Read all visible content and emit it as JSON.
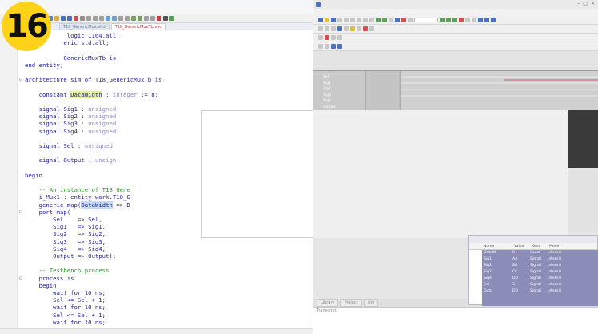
{
  "badge": {
    "number": "16"
  },
  "editor": {
    "tabs": [
      "T18_GenericMux.vhd",
      "T18_GenericMuxTb.vhd"
    ],
    "active_tab": 1,
    "lines": [
      {
        "n": "",
        "fold": "",
        "html": "            <span class='kw'>logic</span> 1164.<span class='kw'>all</span>;"
      },
      {
        "n": "",
        "fold": "",
        "html": "           <span class='kw'>eric</span> std.<span class='kw'>all</span>;"
      },
      {
        "n": "",
        "fold": "",
        "html": ""
      },
      {
        "n": "",
        "fold": "",
        "html": "           GenericMuxTb <span class='kw'>is</span>"
      },
      {
        "n": "",
        "fold": "",
        "html": "<span class='kw'>end entity</span>;"
      },
      {
        "n": "",
        "fold": "",
        "html": ""
      },
      {
        "n": "",
        "fold": "⊟",
        "html": "<span class='kw'>architecture</span> sim <span class='kw'>of</span> T18_GenericMuxTb <span class='kw'>is</span>"
      },
      {
        "n": "",
        "fold": "",
        "html": ""
      },
      {
        "n": "",
        "fold": "",
        "html": "    <span class='kw'>constant</span> <span class='hl'>DataWidth</span> : <span class='ty'>integer</span> := 8;"
      },
      {
        "n": "",
        "fold": "",
        "html": ""
      },
      {
        "n": "",
        "fold": "",
        "html": "    <span class='kw'>signal</span> Sig1 : <span class='ty'>unsigned</span>"
      },
      {
        "n": "",
        "fold": "",
        "html": "    <span class='kw'>signal</span> Sig2 : <span class='ty'>unsigned</span>"
      },
      {
        "n": "",
        "fold": "",
        "html": "    <span class='kw'>signal</span> Sig3 : <span class='ty'>unsigned</span>"
      },
      {
        "n": "",
        "fold": "",
        "html": "    <span class='kw'>signal</span> Sig4 : <span class='ty'>unsigned</span>"
      },
      {
        "n": "",
        "fold": "",
        "html": ""
      },
      {
        "n": "",
        "fold": "",
        "html": "    <span class='kw'>signal</span> Sel : <span class='ty'>unsigned</span>"
      },
      {
        "n": "",
        "fold": "",
        "html": ""
      },
      {
        "n": "",
        "fold": "",
        "html": "    <span class='kw'>signal</span> Output : <span class='ty'>unsign</span>"
      },
      {
        "n": "",
        "fold": "",
        "html": ""
      },
      {
        "n": "",
        "fold": "",
        "html": "<span class='kw'>begin</span>"
      },
      {
        "n": "",
        "fold": "",
        "html": ""
      },
      {
        "n": "",
        "fold": "",
        "html": "    <span class='cm'>-- An instance of T18_Gene</span>"
      },
      {
        "n": "",
        "fold": "",
        "html": "    i_Mux1 : <span class='kw'>entity</span> work.T18_G"
      },
      {
        "n": "",
        "fold": "",
        "html": "    <span class='kw'>generic map</span>(<span class='sel'>DataWidth</span> => D"
      },
      {
        "n": "",
        "fold": "⊟",
        "html": "    <span class='kw'>port map</span>("
      },
      {
        "n": "",
        "fold": "",
        "html": "        Sel    => Sel,"
      },
      {
        "n": "",
        "fold": "",
        "html": "        Sig1   => Sig1,"
      },
      {
        "n": "",
        "fold": "",
        "html": "        Sig2   => Sig2,"
      },
      {
        "n": "",
        "fold": "",
        "html": "        Sig3   => Sig3,"
      },
      {
        "n": "",
        "fold": "",
        "html": "        Sig4   => Sig4,"
      },
      {
        "n": "",
        "fold": "",
        "html": "        Output => Output);"
      },
      {
        "n": "",
        "fold": "",
        "html": ""
      },
      {
        "n": "",
        "fold": "",
        "html": "    <span class='cm'>-- Testbench process</span>"
      },
      {
        "n": "",
        "fold": "⊟",
        "html": "    <span class='kw'>process is</span>"
      },
      {
        "n": "",
        "fold": "",
        "html": "    <span class='kw'>begin</span>"
      },
      {
        "n": "",
        "fold": "",
        "html": "        <span class='kw'>wait for</span> 10 ns;"
      },
      {
        "n": "",
        "fold": "",
        "html": "        Sel <= Sel + 1;"
      },
      {
        "n": "",
        "fold": "",
        "html": "        <span class='kw'>wait for</span> 10 ns;"
      },
      {
        "n": "",
        "fold": "",
        "html": "        Sel <= Sel + 1;"
      },
      {
        "n": "",
        "fold": "",
        "html": "        <span class='kw'>wait for</span> 10 ns;"
      }
    ]
  },
  "sim": {
    "wave": {
      "signals": [
        "Sel",
        "Sig1",
        "Sig2",
        "Sig3",
        "Sig4",
        "Output"
      ]
    },
    "objects": {
      "columns": [
        "Name",
        "Value",
        "Kind",
        "Mode"
      ],
      "rows": [
        {
          "name": "DataW",
          "value": "8",
          "kind": "Const",
          "mode": "Internal"
        },
        {
          "name": "Sig1",
          "value": "AA",
          "kind": "Signal",
          "mode": "Internal"
        },
        {
          "name": "Sig2",
          "value": "BB",
          "kind": "Signal",
          "mode": "Internal"
        },
        {
          "name": "Sig3",
          "value": "CC",
          "kind": "Signal",
          "mode": "Internal"
        },
        {
          "name": "Sig4",
          "value": "DD",
          "kind": "Signal",
          "mode": "Internal"
        },
        {
          "name": "Sel",
          "value": "3",
          "kind": "Signal",
          "mode": "Internal"
        },
        {
          "name": "Outp",
          "value": "DD",
          "kind": "Signal",
          "mode": "Internal"
        }
      ]
    },
    "bottom_tabs": [
      "Library",
      "Project",
      "sim"
    ],
    "transcript_title": "Transcript"
  },
  "colors": {
    "badge": "#ffd21a",
    "objects_body": "#8c8cb8",
    "wave_bg": "#bcbcbc"
  }
}
